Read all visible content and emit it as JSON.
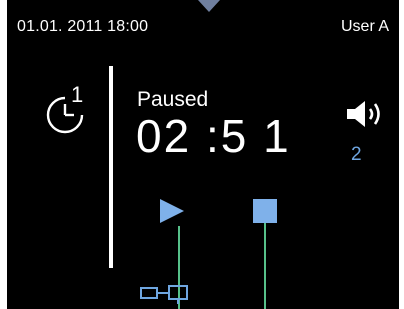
{
  "status_bar": {
    "datetime": "01.01. 2011 18:00",
    "user": "User A"
  },
  "timer": {
    "state": "Paused",
    "time": "02 :5 1"
  },
  "volume": {
    "level": "2"
  },
  "icons": {
    "timer": "timer-icon",
    "volume": "speaker-volume-icon",
    "play": "play-icon",
    "stop": "stop-icon",
    "device": "device-connector-icon"
  },
  "colors": {
    "background": "#000000",
    "text": "#ffffff",
    "accent": "#7fb1ea",
    "connector": "#56c08a",
    "notch": "#6f7f9f"
  }
}
